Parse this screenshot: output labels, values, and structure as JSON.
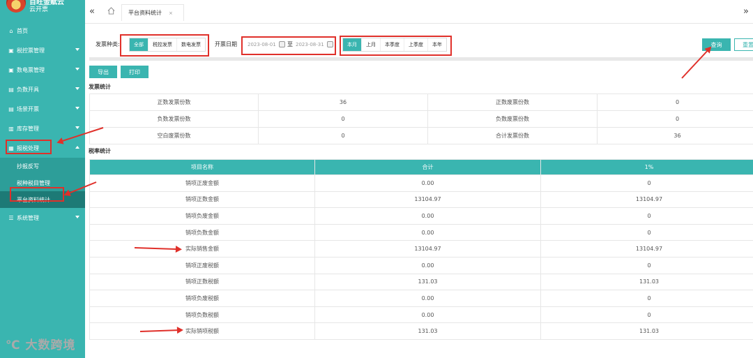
{
  "sidebar": {
    "logo_title": "百旺金赋云",
    "logo_sub": "云开票",
    "items": [
      {
        "label": "首页",
        "icon": "home-icon"
      },
      {
        "label": "税控票管理",
        "icon": "image-icon"
      },
      {
        "label": "数电票管理",
        "icon": "image-icon"
      },
      {
        "label": "负数开具",
        "icon": "doc-icon"
      },
      {
        "label": "场景开票",
        "icon": "doc-icon"
      },
      {
        "label": "库存管理",
        "icon": "box-icon"
      },
      {
        "label": "报税处理",
        "icon": "grid-icon"
      },
      {
        "label": "系统管理",
        "icon": "settings-icon"
      }
    ],
    "submenu": [
      "抄报反写",
      "税种税目管理",
      "平台资料统计"
    ]
  },
  "topbar": {
    "tab_label": "平台资料统计",
    "tab_close": "×"
  },
  "filters": {
    "invoice_type_label": "发票种类:",
    "invoice_types": [
      "全部",
      "税控发票",
      "数电发票"
    ],
    "date_label": "开票日期",
    "date_from": "2023-08-01",
    "date_to_word": "至",
    "date_to": "2023-08-31",
    "periods": [
      "本月",
      "上月",
      "本季度",
      "上季度",
      "本年"
    ],
    "query": "查询",
    "reset": "重置"
  },
  "actions": {
    "export": "导出",
    "print": "打印"
  },
  "invoice_stats": {
    "title": "发票统计",
    "rows": [
      [
        "正数发票份数",
        "36",
        "正数废票份数",
        "0"
      ],
      [
        "负数发票份数",
        "0",
        "负数废票份数",
        "0"
      ],
      [
        "空白废票份数",
        "0",
        "合计发票份数",
        "36"
      ]
    ]
  },
  "tax_stats": {
    "title": "税率统计",
    "headers": [
      "项目名称",
      "合计",
      "1%"
    ],
    "rows": [
      [
        "销项正废金额",
        "0.00",
        "0"
      ],
      [
        "销项正数金额",
        "13104.97",
        "13104.97"
      ],
      [
        "销项负废金额",
        "0.00",
        "0"
      ],
      [
        "销项负数金额",
        "0.00",
        "0"
      ],
      [
        "实际销售金额",
        "13104.97",
        "13104.97"
      ],
      [
        "销项正废税额",
        "0.00",
        "0"
      ],
      [
        "销项正数税额",
        "131.03",
        "131.03"
      ],
      [
        "销项负废税额",
        "0.00",
        "0"
      ],
      [
        "销项负数税额",
        "0.00",
        "0"
      ],
      [
        "实际销项税额",
        "131.03",
        "131.03"
      ]
    ]
  },
  "watermark": "大数跨境",
  "colors": {
    "accent": "#3ab5b0",
    "annotation": "#e0302a"
  }
}
